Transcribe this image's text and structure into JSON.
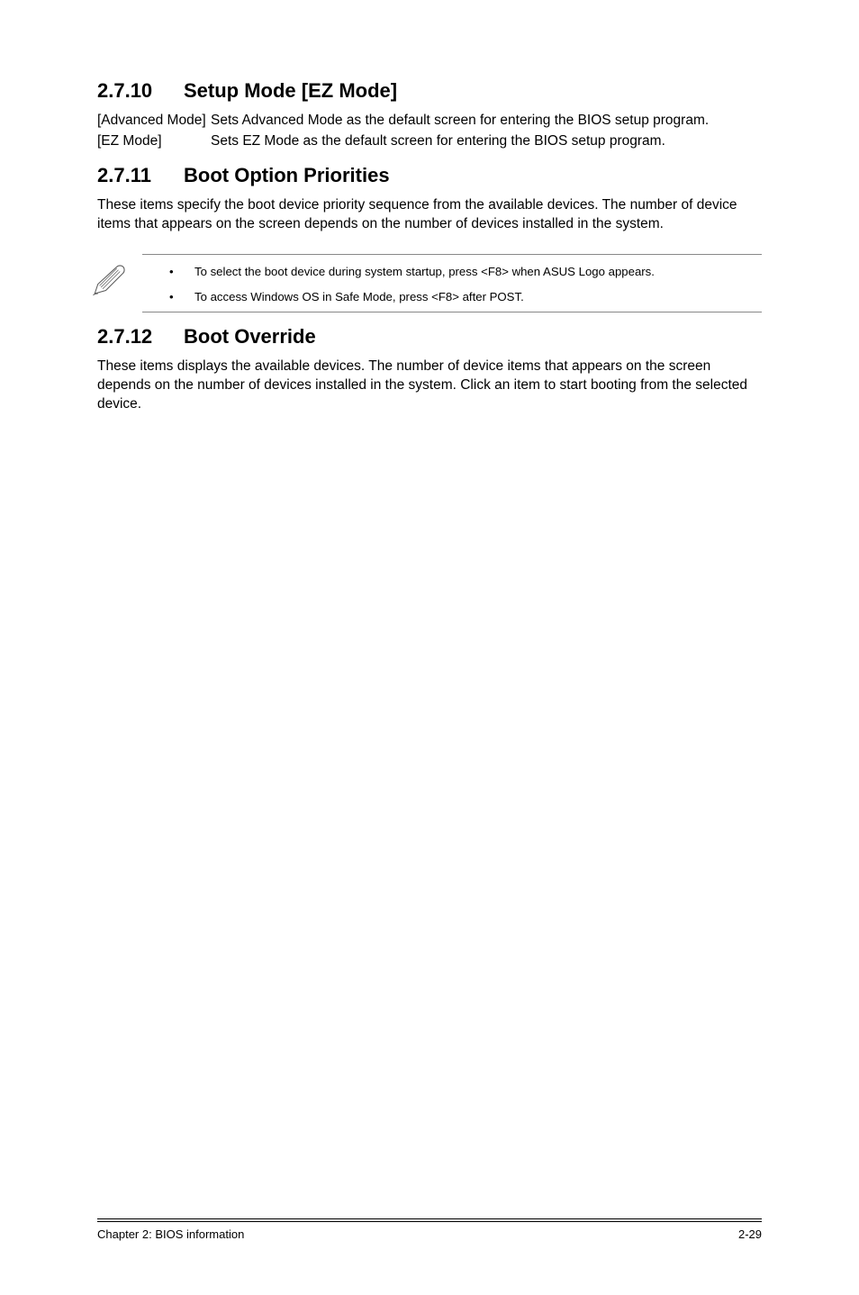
{
  "sections": {
    "s1": {
      "number": "2.7.10",
      "title": "Setup Mode [EZ Mode]",
      "defs": [
        {
          "term": "[Advanced Mode]",
          "desc": "Sets Advanced Mode as the default screen for entering the BIOS setup program."
        },
        {
          "term": "[EZ Mode]",
          "desc": "Sets EZ Mode as the default screen for entering the BIOS setup program."
        }
      ]
    },
    "s2": {
      "number": "2.7.11",
      "title": "Boot Option Priorities",
      "body": "These items specify the boot device priority sequence from the available devices. The number of device items that appears on the screen depends on the number of devices installed in the system.",
      "notes": [
        "To select the boot device during system startup, press <F8> when ASUS Logo appears.",
        "To access Windows OS in Safe Mode, press <F8> after POST."
      ]
    },
    "s3": {
      "number": "2.7.12",
      "title": "Boot Override",
      "body": "These items displays the available devices. The number of device items that appears on the screen depends on the number of devices installed in the system. Click an item to start booting from the selected device."
    }
  },
  "footer": {
    "left": "Chapter 2: BIOS information",
    "right": "2-29"
  }
}
